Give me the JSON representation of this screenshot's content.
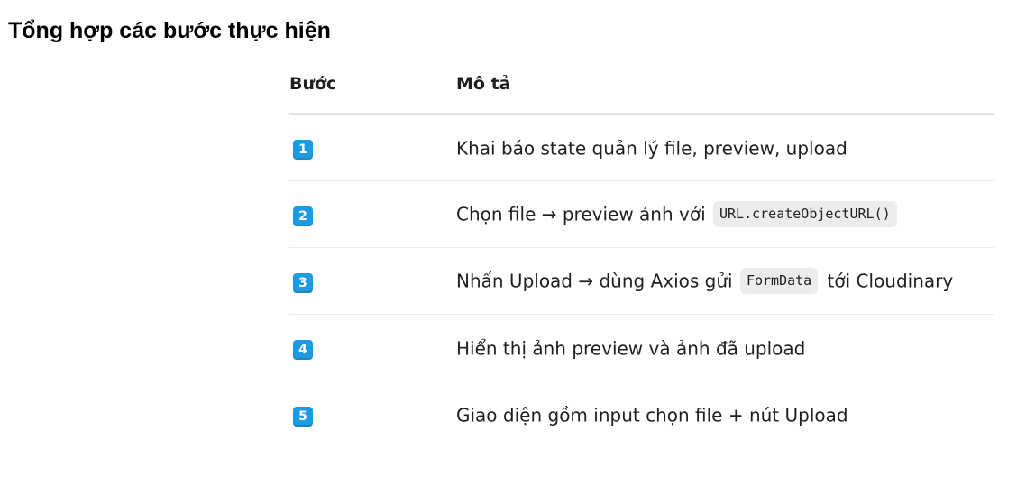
{
  "page": {
    "title": "Tổng hợp các bước thực hiện"
  },
  "table": {
    "headers": {
      "step": "Bước",
      "description": "Mô tả"
    },
    "rows": [
      {
        "badge": "1",
        "badge_color": "#1e9ae0",
        "parts": [
          {
            "type": "text",
            "text": "Khai báo state quản lý file, preview, upload"
          }
        ]
      },
      {
        "badge": "2",
        "badge_color": "#1e9ae0",
        "parts": [
          {
            "type": "text",
            "text": "Chọn file → preview ảnh với "
          },
          {
            "type": "code",
            "text": "URL.createObjectURL()"
          }
        ]
      },
      {
        "badge": "3",
        "badge_color": "#1e9ae0",
        "parts": [
          {
            "type": "text",
            "text": "Nhấn Upload → dùng Axios gửi "
          },
          {
            "type": "code",
            "text": "FormData"
          },
          {
            "type": "text",
            "text": " tới Cloudinary"
          }
        ]
      },
      {
        "badge": "4",
        "badge_color": "#1e9ae0",
        "parts": [
          {
            "type": "text",
            "text": "Hiển thị ảnh preview và ảnh đã upload"
          }
        ]
      },
      {
        "badge": "5",
        "badge_color": "#1e9ae0",
        "parts": [
          {
            "type": "text",
            "text": "Giao diện gồm input chọn file + nút Upload"
          }
        ]
      }
    ]
  }
}
